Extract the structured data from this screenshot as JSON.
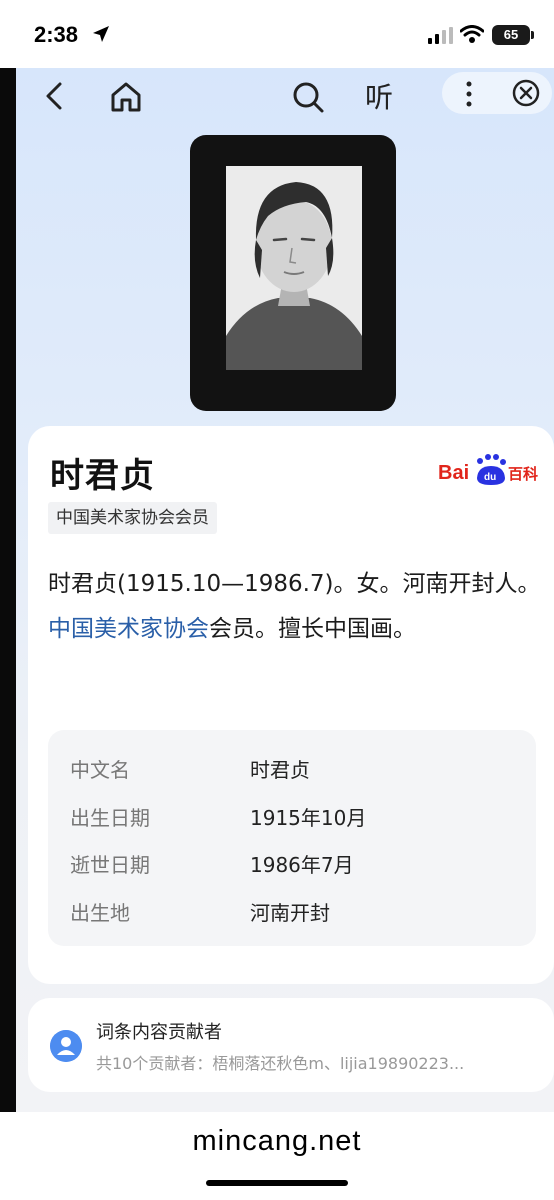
{
  "status_bar": {
    "time": "2:38",
    "battery": "65"
  },
  "nav": {
    "listen_label": "听"
  },
  "entry": {
    "title": "时君贞",
    "tag": "中国美术家协会会员",
    "brand": "Bai du 百科",
    "summary_part1": "时君贞(1915.10—1986.7)。女。河南开封人。",
    "summary_link": "中国美术家协会",
    "summary_part2": "会员。擅长中国画。"
  },
  "info": {
    "rows": [
      {
        "label": "中文名",
        "value": "时君贞"
      },
      {
        "label": "出生日期",
        "value": "1915年10月"
      },
      {
        "label": "逝世日期",
        "value": "1986年7月"
      },
      {
        "label": "出生地",
        "value": "河南开封"
      }
    ]
  },
  "contributors": {
    "title": "词条内容贡献者",
    "subtitle": "共10个贡献者：梧桐落还秋色m、lijia19890223..."
  },
  "footer": {
    "watermark": "mincang.net"
  },
  "colors": {
    "link": "#2a5fa8",
    "baidu_red": "#e1251b",
    "baidu_blue": "#2932e1",
    "avatar": "#4d8cf0"
  }
}
